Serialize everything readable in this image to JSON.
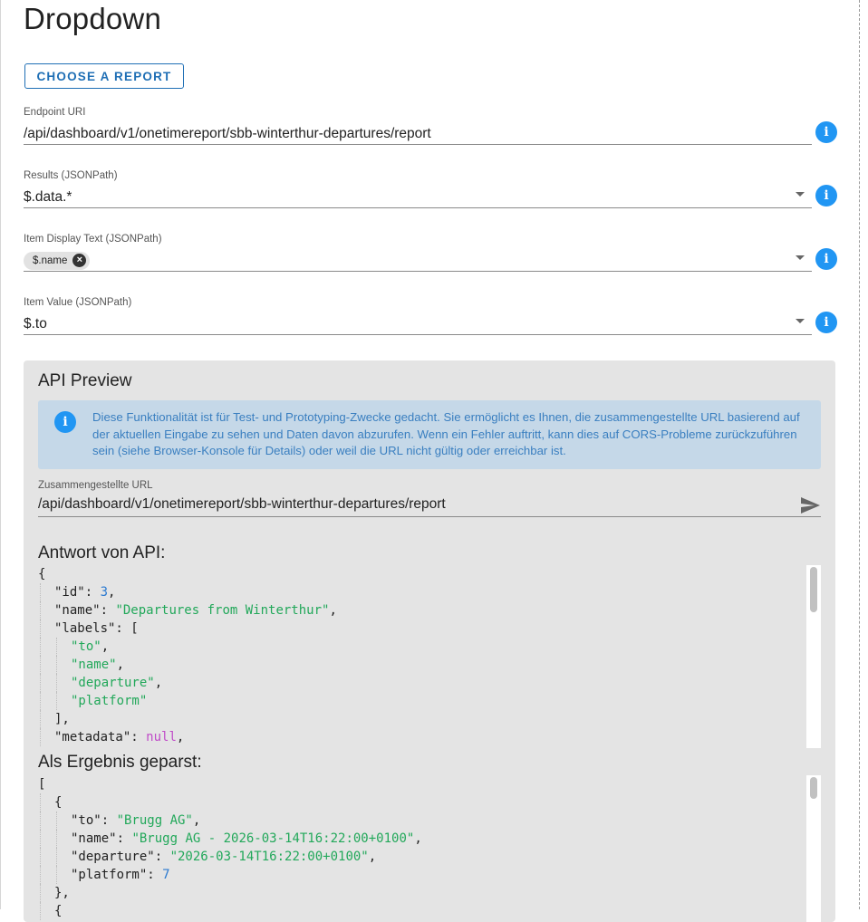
{
  "page": {
    "title": "Dropdown"
  },
  "toolbar": {
    "choose_report_label": "CHOOSE A REPORT"
  },
  "fields": {
    "endpoint_uri": {
      "label": "Endpoint URI",
      "value": "/api/dashboard/v1/onetimereport/sbb-winterthur-departures/report"
    },
    "results": {
      "label": "Results (JSONPath)",
      "value": "$.data.*"
    },
    "item_display_text": {
      "label": "Item Display Text (JSONPath)",
      "chip": "$.name"
    },
    "item_value": {
      "label": "Item Value (JSONPath)",
      "value": "$.to"
    }
  },
  "preview": {
    "title": "API Preview",
    "info_text": "Diese Funktionalität ist für Test- und Prototyping-Zwecke gedacht. Sie ermöglicht es Ihnen, die zusammengestellte URL basierend auf der aktuellen Eingabe zu sehen und Daten davon abzurufen. Wenn ein Fehler auftritt, kann dies auf CORS-Probleme zurückzuführen sein (siehe Browser-Konsole für Details) oder weil die URL nicht gültig oder erreichbar ist.",
    "url_label": "Zusammengestellte URL",
    "url_value": "/api/dashboard/v1/onetimereport/sbb-winterthur-departures/report",
    "response_title": "Antwort von API:",
    "parsed_title": "Als Ergebnis geparst:",
    "response_lines": [
      {
        "indent": 0,
        "parts": [
          [
            "p",
            "{"
          ]
        ]
      },
      {
        "indent": 1,
        "parts": [
          [
            "p",
            "\"id\": "
          ],
          [
            "num",
            "3"
          ],
          [
            "p",
            ","
          ]
        ]
      },
      {
        "indent": 1,
        "parts": [
          [
            "p",
            "\"name\": "
          ],
          [
            "str",
            "\"Departures from Winterthur\""
          ],
          [
            "p",
            ","
          ]
        ]
      },
      {
        "indent": 1,
        "parts": [
          [
            "p",
            "\"labels\": ["
          ]
        ]
      },
      {
        "indent": 2,
        "parts": [
          [
            "str",
            "\"to\""
          ],
          [
            "p",
            ","
          ]
        ]
      },
      {
        "indent": 2,
        "parts": [
          [
            "str",
            "\"name\""
          ],
          [
            "p",
            ","
          ]
        ]
      },
      {
        "indent": 2,
        "parts": [
          [
            "str",
            "\"departure\""
          ],
          [
            "p",
            ","
          ]
        ]
      },
      {
        "indent": 2,
        "parts": [
          [
            "str",
            "\"platform\""
          ]
        ]
      },
      {
        "indent": 1,
        "parts": [
          [
            "p",
            "],"
          ]
        ]
      },
      {
        "indent": 1,
        "parts": [
          [
            "p",
            "\"metadata\": "
          ],
          [
            "kw",
            "null"
          ],
          [
            "p",
            ","
          ]
        ]
      }
    ],
    "parsed_lines": [
      {
        "indent": 0,
        "parts": [
          [
            "p",
            "["
          ]
        ]
      },
      {
        "indent": 1,
        "parts": [
          [
            "p",
            "{"
          ]
        ]
      },
      {
        "indent": 2,
        "parts": [
          [
            "p",
            "\"to\": "
          ],
          [
            "str",
            "\"Brugg AG\""
          ],
          [
            "p",
            ","
          ]
        ]
      },
      {
        "indent": 2,
        "parts": [
          [
            "p",
            "\"name\": "
          ],
          [
            "str",
            "\"Brugg AG - 2026-03-14T16:22:00+0100\""
          ],
          [
            "p",
            ","
          ]
        ]
      },
      {
        "indent": 2,
        "parts": [
          [
            "p",
            "\"departure\": "
          ],
          [
            "str",
            "\"2026-03-14T16:22:00+0100\""
          ],
          [
            "p",
            ","
          ]
        ]
      },
      {
        "indent": 2,
        "parts": [
          [
            "p",
            "\"platform\": "
          ],
          [
            "num",
            "7"
          ]
        ]
      },
      {
        "indent": 1,
        "parts": [
          [
            "p",
            "},"
          ]
        ]
      },
      {
        "indent": 1,
        "parts": [
          [
            "p",
            "{"
          ]
        ]
      }
    ]
  },
  "colors": {
    "accent": "#1f6fb5",
    "info": "#2196f3",
    "string": "#22a85a",
    "number": "#2b7ad0",
    "keyword": "#c04cc8"
  },
  "icons": {
    "info": "info-icon",
    "send": "send-icon",
    "dropdown": "chevron-down-icon",
    "chip_close": "close-icon"
  }
}
